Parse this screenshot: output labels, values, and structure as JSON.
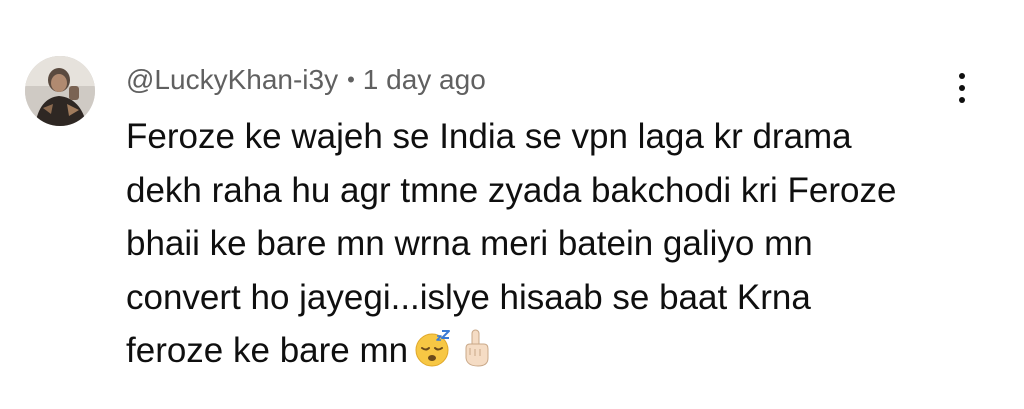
{
  "comment": {
    "author_handle": "@LuckyKhan-i3y",
    "separator": "•",
    "timestamp": "1 day ago",
    "text_lines": [
      "Feroze ke wajeh se India se vpn laga kr drama",
      "dekh raha hu agr tmne zyada bakchodi kri Feroze",
      "bhaii ke bare mn wrna meri batein galiyo mn",
      "convert ho jayegi...islye hisaab se baat Krna",
      "feroze ke bare mn"
    ],
    "emojis": [
      "sleeping-face-emoji",
      "index-pointing-up-emoji"
    ],
    "avatar_icon": "user-avatar",
    "menu_icon": "more-vert-icon"
  },
  "colors": {
    "meta_text": "#606060",
    "body_text": "#0f0f0f",
    "background": "#ffffff"
  }
}
